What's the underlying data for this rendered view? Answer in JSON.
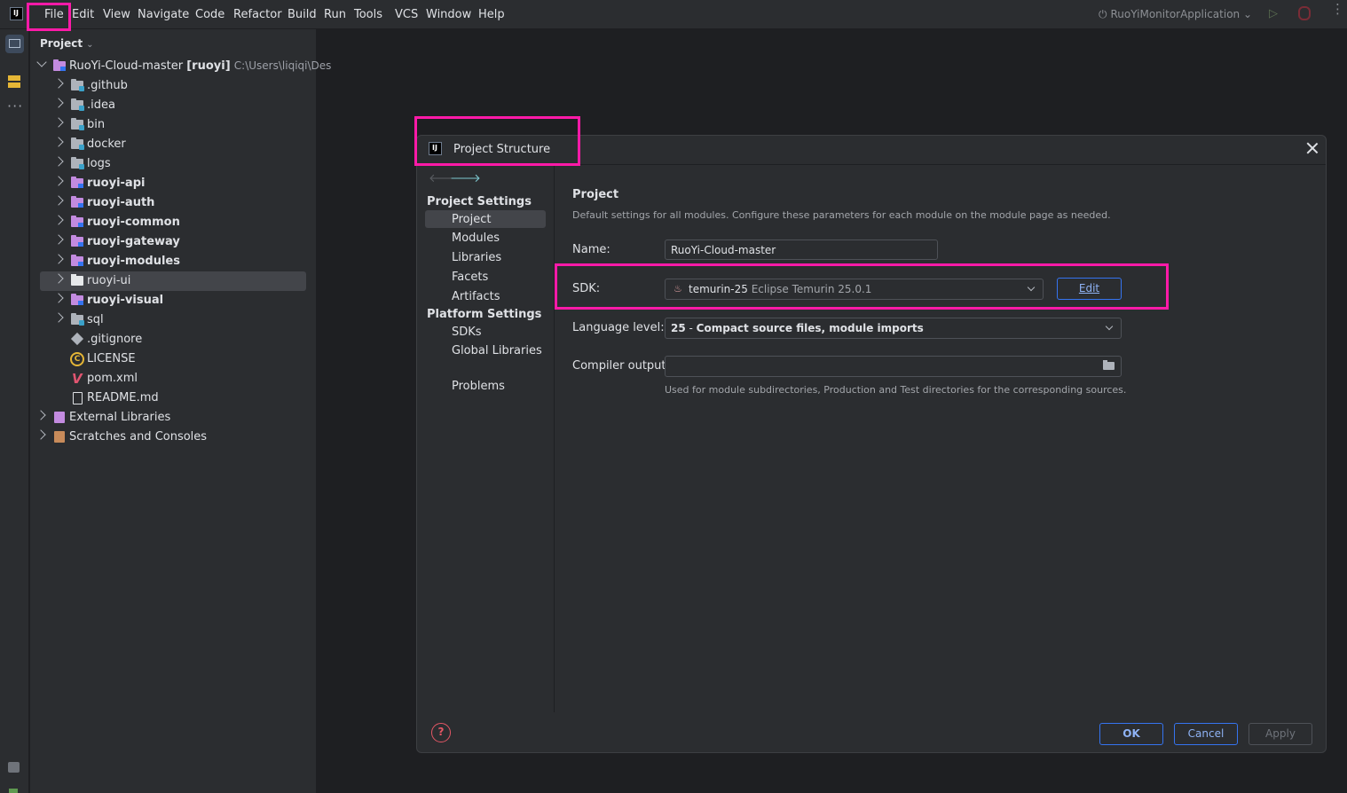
{
  "menubar": {
    "items": [
      "File",
      "Edit",
      "View",
      "Navigate",
      "Code",
      "Refactor",
      "Build",
      "Run",
      "Tools",
      "VCS",
      "Window",
      "Help"
    ],
    "run_config": "RuoYiMonitorApplication"
  },
  "project_panel": {
    "title": "Project",
    "root": {
      "name": "RuoYi-Cloud-master",
      "module": "[ruoyi]",
      "path": "C:\\Users\\liqiqi\\Des"
    },
    "items": [
      {
        "label": ".github"
      },
      {
        "label": ".idea"
      },
      {
        "label": "bin"
      },
      {
        "label": "docker"
      },
      {
        "label": "logs"
      },
      {
        "label": "ruoyi-api"
      },
      {
        "label": "ruoyi-auth"
      },
      {
        "label": "ruoyi-common"
      },
      {
        "label": "ruoyi-gateway"
      },
      {
        "label": "ruoyi-modules"
      },
      {
        "label": "ruoyi-ui"
      },
      {
        "label": "ruoyi-visual"
      },
      {
        "label": "sql"
      },
      {
        "label": ".gitignore"
      },
      {
        "label": "LICENSE"
      },
      {
        "label": "pom.xml"
      },
      {
        "label": "README.md"
      }
    ],
    "external_libraries": "External Libraries",
    "scratches": "Scratches and Consoles"
  },
  "dialog": {
    "title": "Project Structure",
    "sidebar": {
      "project_settings": "Project Settings",
      "project_items": [
        "Project",
        "Modules",
        "Libraries",
        "Facets",
        "Artifacts"
      ],
      "platform_settings": "Platform Settings",
      "platform_items": [
        "SDKs",
        "Global Libraries"
      ],
      "problems": "Problems"
    },
    "content": {
      "title": "Project",
      "description": "Default settings for all modules. Configure these parameters for each module on the module page as needed.",
      "name_label": "Name:",
      "name_value": "RuoYi-Cloud-master",
      "sdk_label": "SDK:",
      "sdk_name": "temurin-25",
      "sdk_detail": "Eclipse Temurin 25.0.1",
      "edit_label": "Edit",
      "language_label": "Language level:",
      "language_num": "25",
      "language_sep": " - ",
      "language_value": "Compact source files, module imports",
      "compiler_label": "Compiler output:",
      "compiler_value": "",
      "compiler_hint": "Used for module subdirectories, Production and Test directories for the corresponding sources."
    },
    "buttons": {
      "ok": "OK",
      "cancel": "Cancel",
      "apply": "Apply",
      "help": "?"
    }
  },
  "colors": {
    "highlight": "#ff1aa8",
    "accent": "#3574f0",
    "background": "#1e1f22",
    "panel": "#2b2d30"
  }
}
